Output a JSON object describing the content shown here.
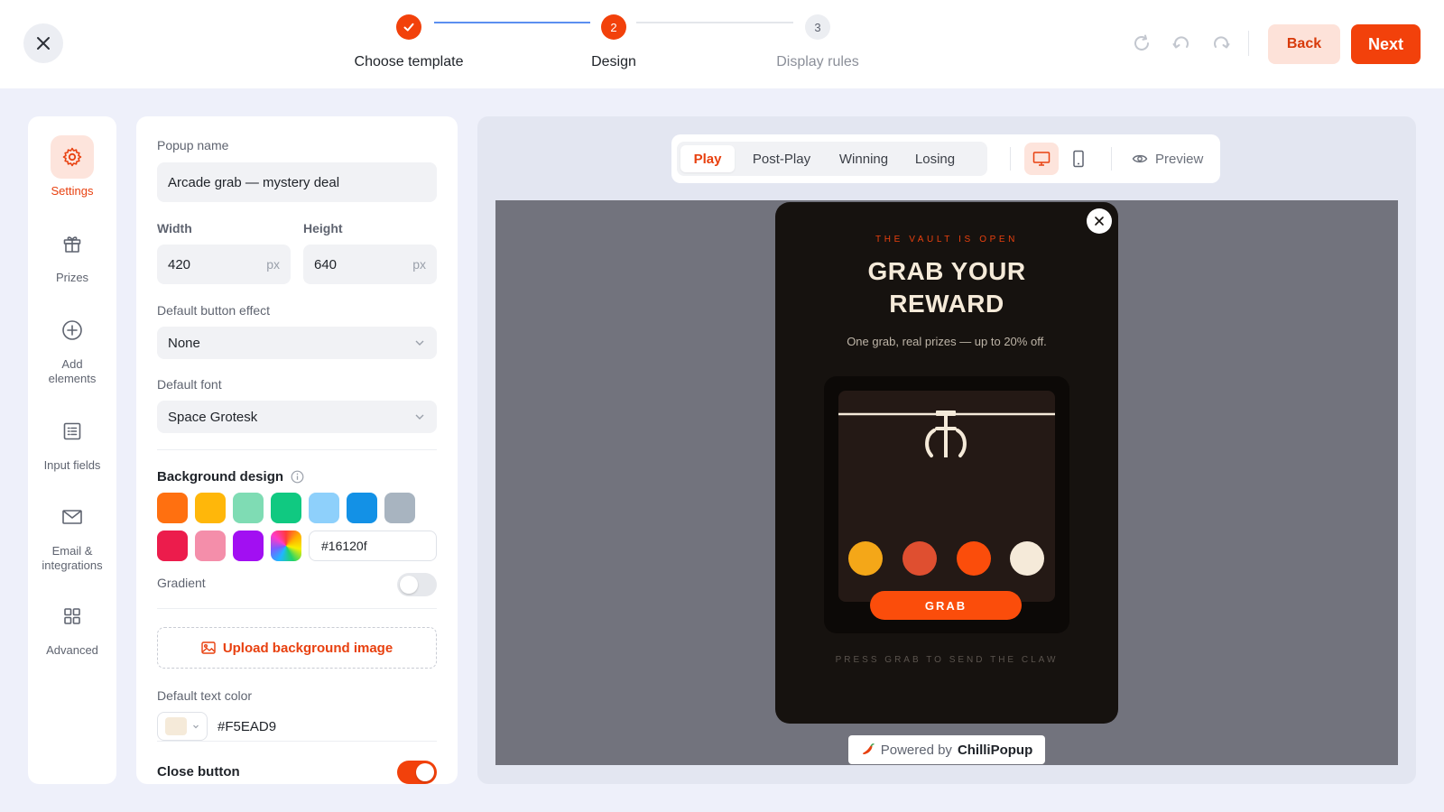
{
  "header": {
    "steps": [
      {
        "label": "Choose template",
        "number": "✓",
        "state": "done"
      },
      {
        "label": "Design",
        "number": "2",
        "state": "active"
      },
      {
        "label": "Display rules",
        "number": "3",
        "state": "todo"
      }
    ],
    "back_label": "Back",
    "next_label": "Next",
    "colors": {
      "accent": "#f2410b",
      "connector_done": "#5b8ff0"
    }
  },
  "rail": {
    "items": [
      {
        "label": "Settings",
        "icon": "gear-icon",
        "active": true
      },
      {
        "label": "Prizes",
        "icon": "gift-icon"
      },
      {
        "label": "Add elements",
        "icon": "plus-circle-icon"
      },
      {
        "label": "Input fields",
        "icon": "list-icon"
      },
      {
        "label": "Email & integrations",
        "icon": "envelope-icon"
      },
      {
        "label": "Advanced",
        "icon": "grid-icon"
      }
    ]
  },
  "settings": {
    "popup_name_label": "Popup name",
    "popup_name_value": "Arcade grab — mystery deal",
    "width_label": "Width",
    "width_value": "420",
    "height_label": "Height",
    "height_value": "640",
    "unit": "px",
    "button_effect_label": "Default button effect",
    "button_effect_value": "None",
    "font_label": "Default font",
    "font_value": "Space Grotesk",
    "background_label": "Background design",
    "swatches": [
      "#ff7010",
      "#ffb70a",
      "#7fdcb4",
      "#10c981",
      "#8ed0fb",
      "#1391e6",
      "#a8b4c0",
      "#ec1c4c",
      "#f48eaa",
      "#a20ff2"
    ],
    "background_hex": "#16120f",
    "gradient_label": "Gradient",
    "gradient_on": false,
    "upload_label": "Upload background image",
    "text_color_label": "Default text color",
    "text_color_value": "#F5EAD9",
    "close_button_label": "Close button",
    "close_button_on": true
  },
  "preview": {
    "tabs": [
      "Play",
      "Post-Play",
      "Winning",
      "Losing"
    ],
    "active_tab": "Play",
    "preview_label": "Preview",
    "popup": {
      "eyebrow": "THE VAULT IS OPEN",
      "title_line1": "GRAB YOUR",
      "title_line2": "REWARD",
      "subtitle": "One grab, real prizes — up to 20% off.",
      "ball_colors": [
        "#f4a718",
        "#df4f30",
        "#fb4d0b",
        "#f5ead9"
      ],
      "grab_label": "GRAB",
      "hint": "PRESS GRAB TO SEND THE CLAW"
    },
    "powered_prefix": "Powered by",
    "powered_brand": "ChilliPopup"
  }
}
